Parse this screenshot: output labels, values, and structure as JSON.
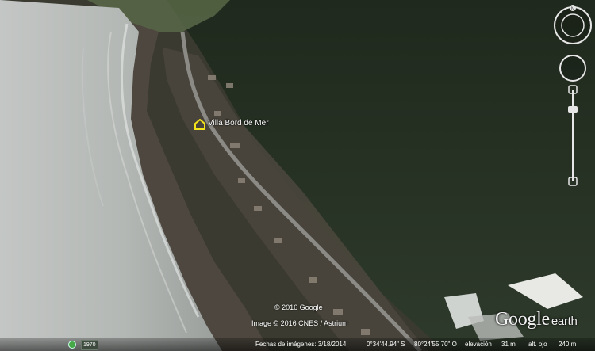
{
  "placemark": {
    "label": "Villa Bord de Mer",
    "icon": "house-icon",
    "color": "#f4e21a"
  },
  "copyright": {
    "line1": "© 2016 Google",
    "line2": "Image © 2016 CNES / Astrium"
  },
  "logo": {
    "google": "Google",
    "earth": "earth"
  },
  "navigation": {
    "compass_north": "N",
    "icons": [
      "compass-ring-icon",
      "look-joystick-icon",
      "zoom-slider-icon"
    ]
  },
  "statusbar": {
    "year": "1970",
    "imagery_date": "Fechas de imágenes: 3/18/2014",
    "latitude": "0°34'44.94\" S",
    "longitude": "80°24'55.70\" O",
    "elevation_label": "elevación",
    "elevation_value": "31 m",
    "eye_alt_label": "alt. ojo",
    "eye_alt_value": "240 m"
  },
  "colors": {
    "ocean": "#b7bcb9",
    "beach": "#4d473f",
    "forest": "#263024",
    "road": "#8b8a85"
  }
}
